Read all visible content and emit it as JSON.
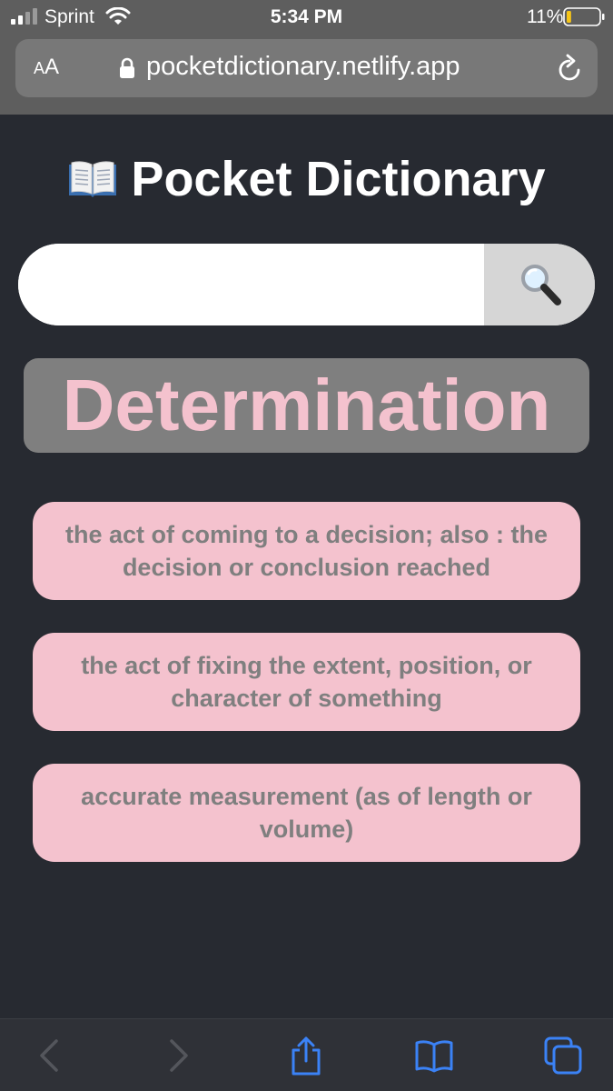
{
  "status_bar": {
    "carrier": "Sprint",
    "time": "5:34 PM",
    "battery_percent": "11%",
    "battery_level": 0.11
  },
  "browser": {
    "text_size_label_small": "A",
    "text_size_label_large": "A",
    "url": "pocketdictionary.netlify.app",
    "icons": {
      "lock": "lock-icon",
      "reload": "reload-icon",
      "back": "chevron-left-icon",
      "forward": "chevron-right-icon",
      "share": "share-icon",
      "bookmarks": "open-book-icon",
      "tabs": "tabs-icon"
    }
  },
  "app": {
    "title": "Pocket Dictionary",
    "title_icon": "open-book-emoji-icon",
    "search": {
      "value": "",
      "placeholder": "",
      "button_icon": "magnifying-glass-icon"
    },
    "word": "Determination",
    "definitions": [
      "the act of coming to a decision; also : the decision or conclusion reached",
      "the act of fixing the extent, position, or character of something",
      "accurate measurement (as of length or volume)"
    ]
  },
  "colors": {
    "page_background": "#272a31",
    "chrome_background": "#5e5e5e",
    "url_bar": "#787878",
    "accent_pink": "#f4c2ce",
    "word_box": "#7f7f7f",
    "definition_text": "#7f7f7f",
    "search_button": "#d6d6d6",
    "toolbar_disabled": "#54565c",
    "toolbar_active": "#3b82f6"
  }
}
